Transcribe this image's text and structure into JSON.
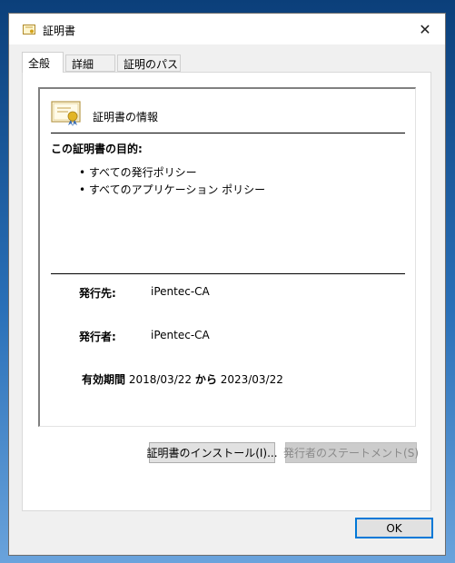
{
  "window": {
    "title": "証明書",
    "close_glyph": "✕"
  },
  "tabs": [
    {
      "label": "全般",
      "active": true
    },
    {
      "label": "詳細",
      "active": false
    },
    {
      "label": "証明のパス",
      "active": false
    }
  ],
  "general": {
    "heading": "証明書の情報",
    "purpose_title": "この証明書の目的:",
    "purposes": [
      "• すべての発行ポリシー",
      "• すべてのアプリケーション ポリシー"
    ],
    "issued_to_label": "発行先:",
    "issued_to_value": "iPentec-CA",
    "issued_by_label": "発行者:",
    "issued_by_value": "iPentec-CA",
    "validity_label": "有効期間",
    "valid_from": "2018/03/22",
    "validity_sep": "から",
    "valid_to": "2023/03/22"
  },
  "buttons": {
    "install": "証明書のインストール(I)...",
    "issuer_statement": "発行者のステートメント(S)",
    "ok": "OK"
  },
  "colors": {
    "accent": "#0078d7",
    "desktop": "#1e5b9e"
  }
}
